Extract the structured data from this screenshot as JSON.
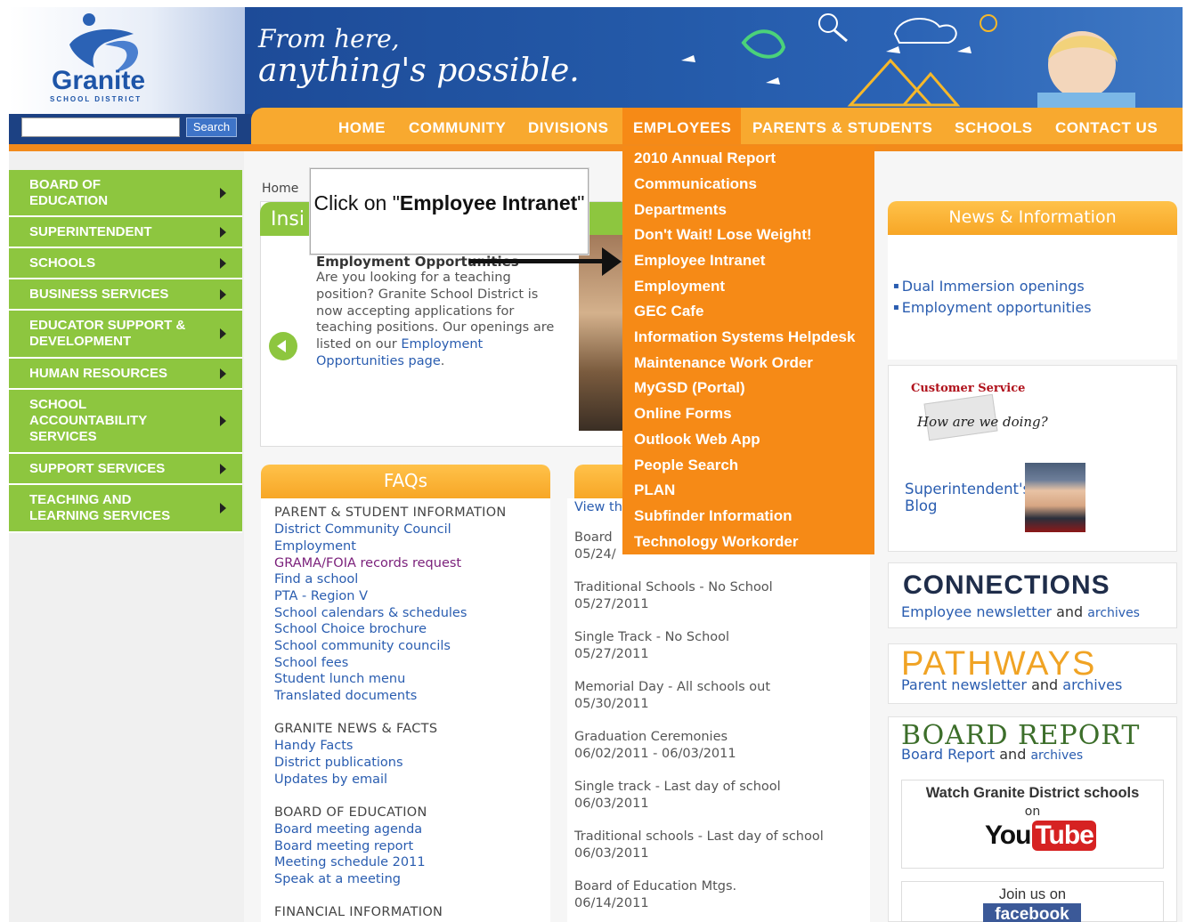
{
  "header": {
    "logo_text": "Granite",
    "logo_subtext": "SCHOOL DISTRICT",
    "tagline_line1": "From here,",
    "tagline_line2": "anything's possible.",
    "search_button": "Search",
    "search_value": ""
  },
  "nav": {
    "items": [
      "HOME",
      "COMMUNITY",
      "DIVISIONS",
      "EMPLOYEES",
      "PARENTS & STUDENTS",
      "SCHOOLS",
      "CONTACT US"
    ]
  },
  "dropdown": {
    "items": [
      "2010 Annual Report",
      "Communications",
      "Departments",
      "Don't Wait! Lose Weight!",
      "Employee Intranet",
      "Employment",
      "GEC Cafe",
      "Information Systems Helpdesk",
      "Maintenance Work Order",
      "MyGSD (Portal)",
      "Online Forms",
      "Outlook Web App",
      "People Search",
      "PLAN",
      "Subfinder Information",
      "Technology Workorder"
    ]
  },
  "sidebar": {
    "items": [
      "BOARD OF EDUCATION",
      "SUPERINTENDENT",
      "SCHOOLS",
      "BUSINESS SERVICES",
      "EDUCATOR SUPPORT & DEVELOPMENT",
      "HUMAN RESOURCES",
      "SCHOOL ACCOUNTABILITY SERVICES",
      "SUPPORT SERVICES",
      "TEACHING AND LEARNING SERVICES"
    ]
  },
  "breadcrumb": "Home",
  "callout": {
    "before": "Click on \"",
    "bold": "Employee Intranet",
    "after": "\""
  },
  "feature": {
    "tab": "Insi",
    "title": "Employment Opportunities",
    "body": "Are you looking for a teaching position? Granite School District is now accepting applications for teaching positions. Our openings are listed on our ",
    "link": "Employment Opportunities page",
    "end": "."
  },
  "faq": {
    "title": "FAQs",
    "sections": [
      {
        "heading": "PARENT & STUDENT INFORMATION",
        "links": [
          "District Community Council",
          "Employment",
          "GRAMA/FOIA records request",
          "Find a school",
          "PTA - Region V",
          "School calendars & schedules",
          "School Choice brochure",
          "School community councils",
          "School fees",
          "Student lunch menu",
          "Translated documents"
        ]
      },
      {
        "heading": "GRANITE NEWS & FACTS",
        "links": [
          "Handy Facts",
          "District publications",
          "Updates by email"
        ]
      },
      {
        "heading": "BOARD OF EDUCATION",
        "links": [
          "Board meeting agenda",
          "Board meeting report",
          "Meeting schedule 2011",
          "Speak at a meeting"
        ]
      },
      {
        "heading": "FINANCIAL INFORMATION",
        "links": []
      }
    ]
  },
  "events": {
    "view": "View th",
    "items": [
      {
        "title": "Board",
        "date": "05/24/"
      },
      {
        "title": "Traditional Schools - No School",
        "date": "05/27/2011"
      },
      {
        "title": "Single Track - No School",
        "date": "05/27/2011"
      },
      {
        "title": "Memorial Day - All schools out",
        "date": "05/30/2011"
      },
      {
        "title": "Graduation Ceremonies",
        "date": "06/02/2011 - 06/03/2011"
      },
      {
        "title": "Single track - Last day of school",
        "date": "06/03/2011"
      },
      {
        "title": "Traditional schools - Last day of school",
        "date": "06/03/2011"
      },
      {
        "title": "Board of Education Mtgs.",
        "date": "06/14/2011"
      }
    ]
  },
  "right": {
    "news_title": "News & Information",
    "news_links": [
      "Dual Immersion openings",
      "Employment opportunities"
    ],
    "customer_service": "Customer Service",
    "how_doing": "How are we doing?",
    "superintendent_blog": "Superintendent's Blog",
    "connections": "CONNECTIONS",
    "connections_sub": "Employee newsletter",
    "and": "and",
    "archives": "archives",
    "pathways": "PATHWAYS",
    "pathways_sub": "Parent newsletter",
    "board_report": "BOARD REPORT",
    "board_report_sub": "Board Report",
    "youtube_title": "Watch Granite District schools",
    "youtube_on": "on",
    "youtube_you": "You",
    "youtube_tube": "Tube",
    "facebook_title": "Join us on",
    "facebook_logo": "facebook"
  },
  "colors": {
    "nav_orange": "#f8a92f",
    "dropdown_orange": "#f68a16",
    "sidebar_green": "#8dc63f",
    "link_blue": "#2a5db0",
    "header_blue": "#1d4b98"
  }
}
